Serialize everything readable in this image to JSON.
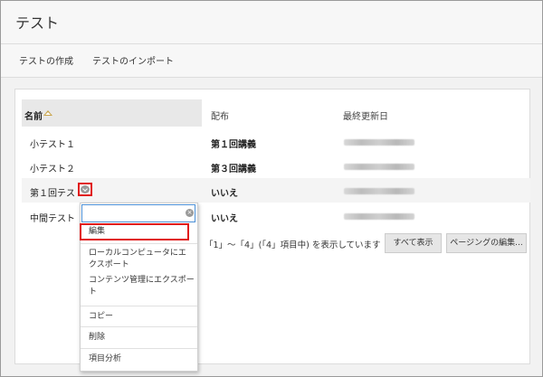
{
  "page": {
    "title": "テスト"
  },
  "actions": [
    {
      "label": "テストの作成"
    },
    {
      "label": "テストのインポート"
    }
  ],
  "table": {
    "columns": [
      "名前",
      "配布",
      "最終更新日"
    ],
    "sort": {
      "column": "名前",
      "direction": "ascending"
    },
    "rows": [
      {
        "name": "小テスト１",
        "distribution": "第１回講義"
      },
      {
        "name": "小テスト２",
        "distribution": "第３回講義"
      },
      {
        "name": "第１回テスト",
        "distribution": "いいえ"
      },
      {
        "name": "中間テスト",
        "distribution": "いいえ"
      }
    ]
  },
  "dropdown": {
    "search_value": "",
    "items": [
      "編集",
      "ローカルコンピュータにエクスポート",
      "コンテンツ管理にエクスポート",
      "コピー",
      "削除",
      "項目分析"
    ]
  },
  "paging": {
    "summary": "「1」～「4」(「4」項目中) を表示しています",
    "show_all_label": "すべて表示",
    "edit_paging_label": "ページングの編集..."
  },
  "colors": {
    "highlight_border": "#e01616",
    "header_bg": "#f7f7f7",
    "sort_arrow": "#c8a44a",
    "search_border": "#4a8fd6"
  }
}
